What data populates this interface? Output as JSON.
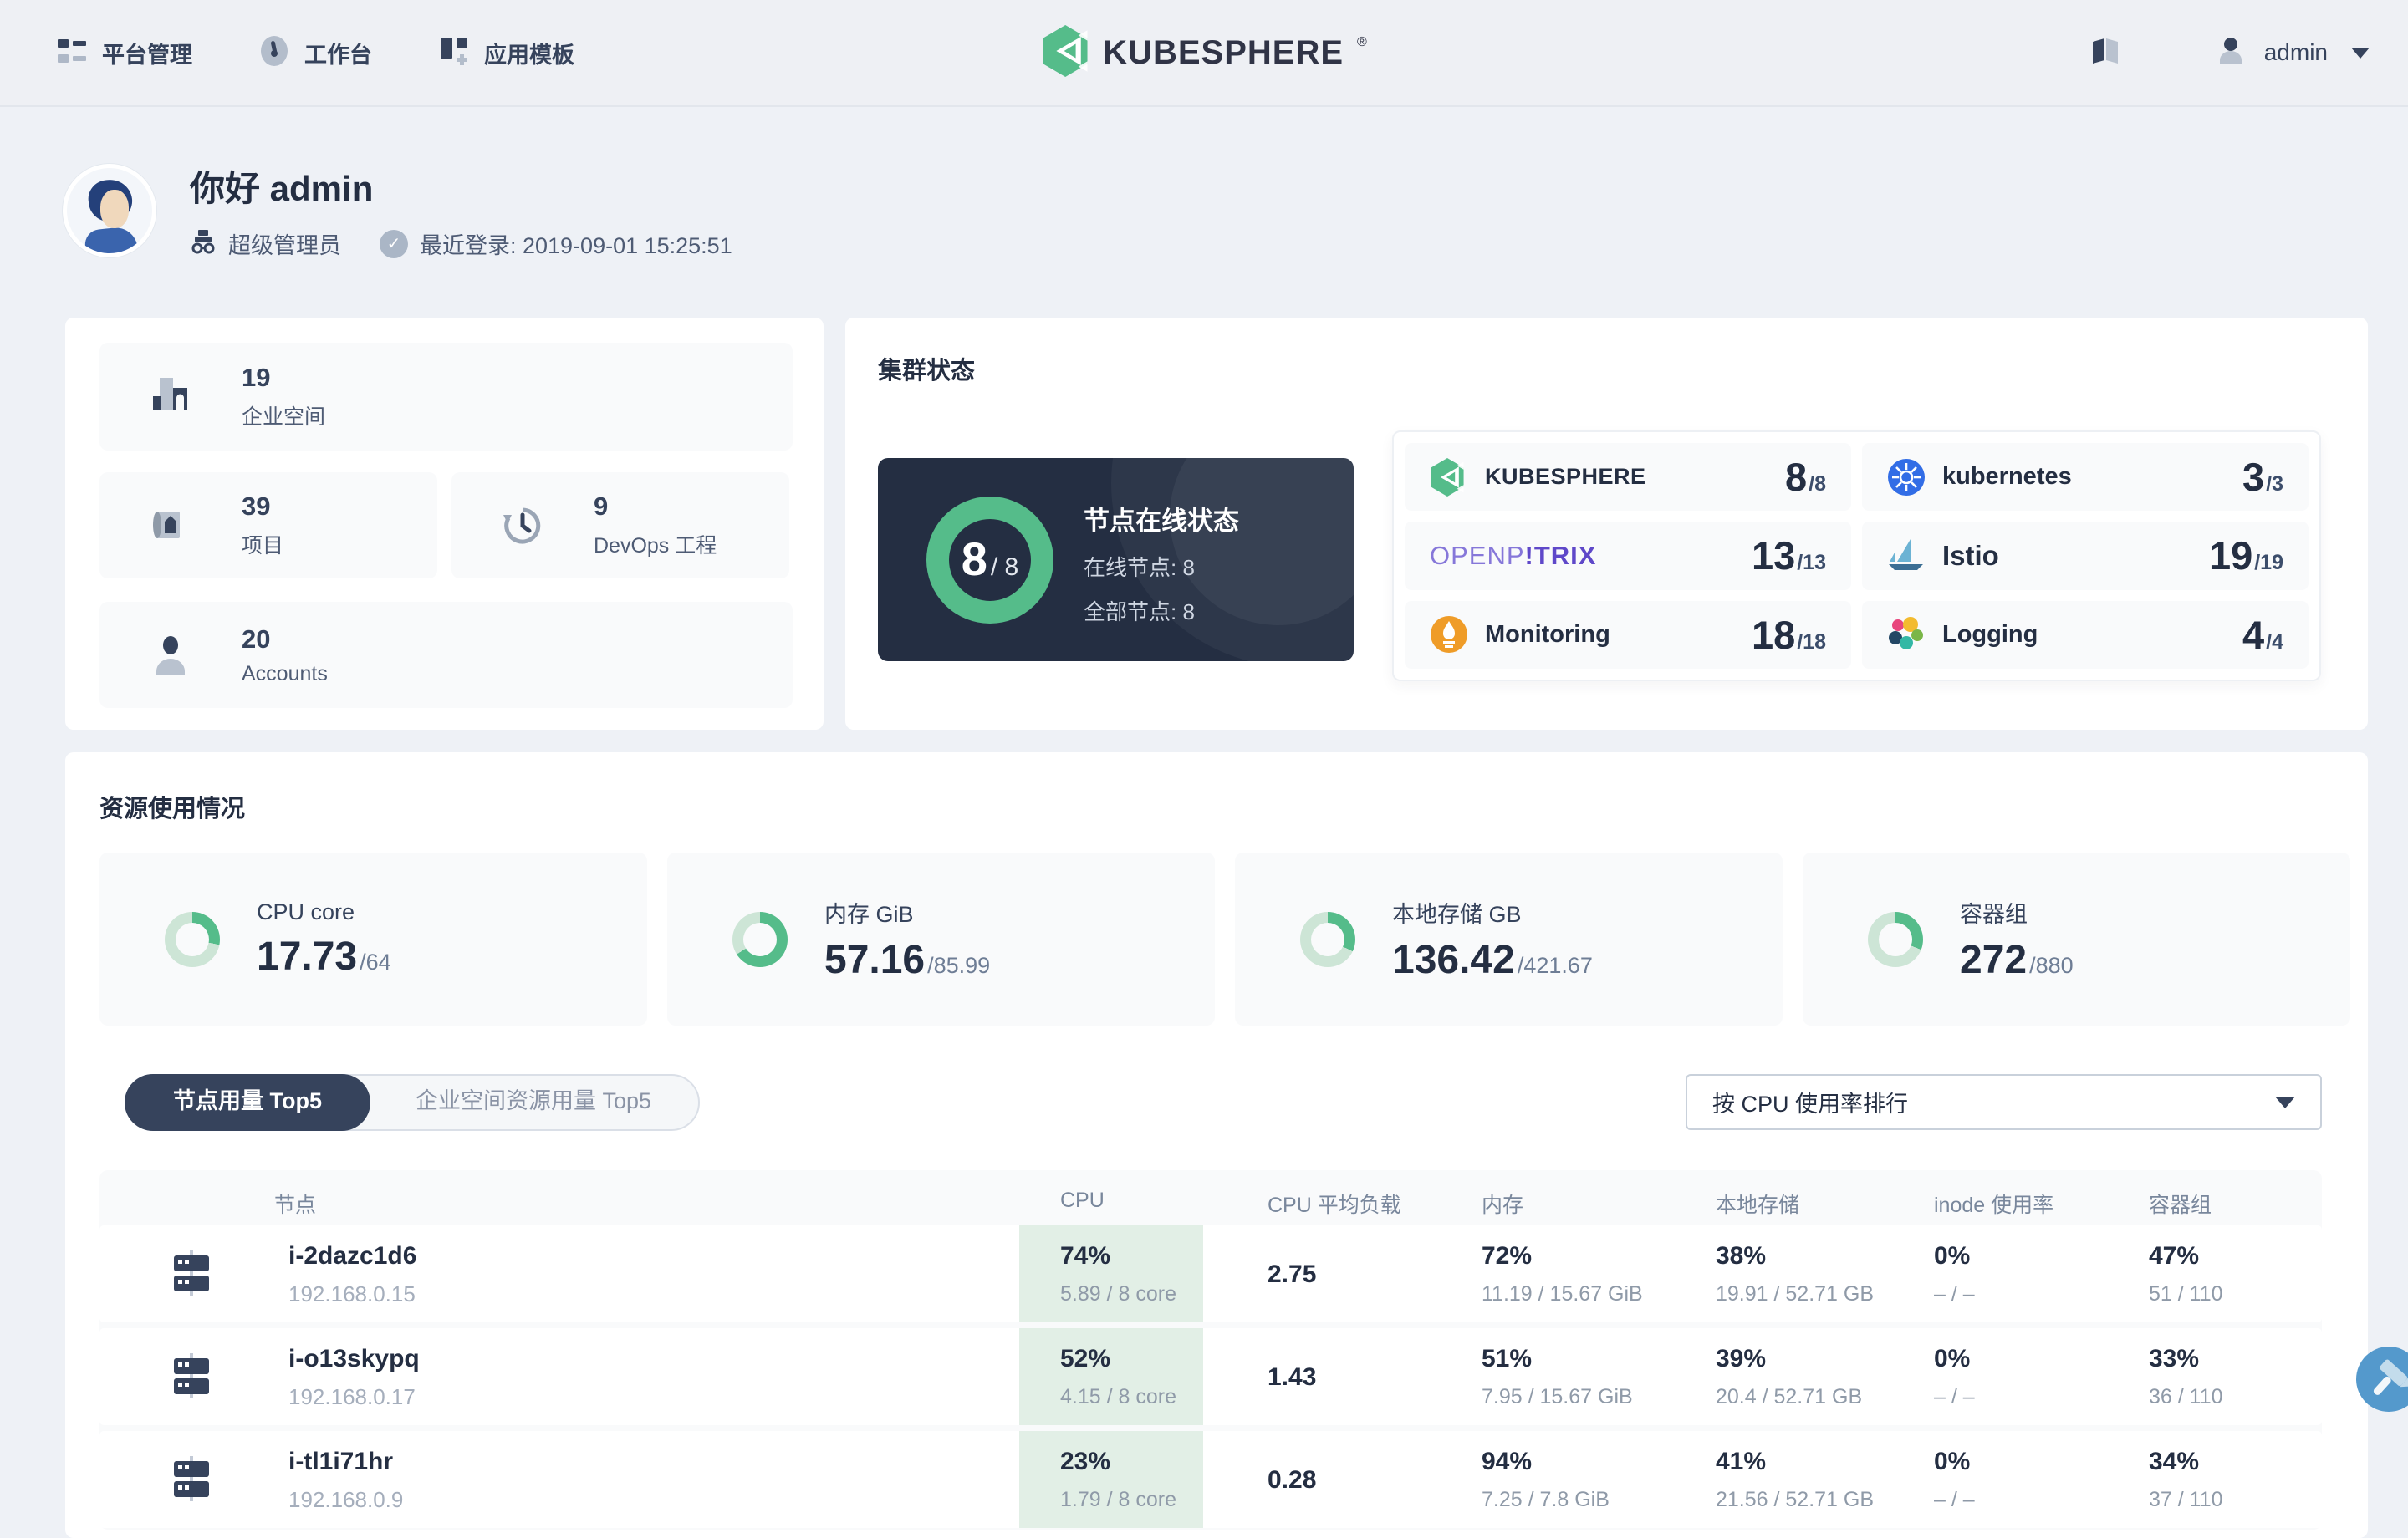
{
  "colors": {
    "green": "#55bc8a",
    "green_track": "#cde5d6",
    "dark_navy": "#242e42",
    "kubernetes_blue": "#326de6",
    "monitoring_orange": "#ef9c28",
    "fab_blue": "#5499cc",
    "cpu_cell_bg": "#e2efe6"
  },
  "nav": {
    "items": [
      {
        "label": "平台管理",
        "icon": "platform-list-icon"
      },
      {
        "label": "工作台",
        "icon": "workbench-gauge-icon"
      },
      {
        "label": "应用模板",
        "icon": "app-template-icon"
      }
    ],
    "brand": "KUBESPHERE",
    "brand_reg": "®",
    "user": "admin"
  },
  "greeting": {
    "hello": "你好 admin",
    "role": "超级管理员",
    "last_login": "最近登录: 2019-09-01 15:25:51"
  },
  "stats": [
    {
      "value": "19",
      "label": "企业空间"
    },
    {
      "value": "39",
      "label": "项目"
    },
    {
      "value": "9",
      "label": "DevOps 工程"
    },
    {
      "value": "20",
      "label": "Accounts"
    }
  ],
  "cluster": {
    "title": "集群状态",
    "donut_value": "8",
    "donut_total": "/ 8",
    "node_status_title": "节点在线状态",
    "online_line": "在线节点: 8",
    "total_line": "全部节点: 8",
    "services": [
      {
        "name": "KUBESPHERE",
        "value": "8",
        "total": "/8"
      },
      {
        "name": "kubernetes",
        "value": "3",
        "total": "/3"
      },
      {
        "name_a": "OPENP",
        "name_b": "!TRIX",
        "value": "13",
        "total": "/13"
      },
      {
        "name": "Istio",
        "value": "19",
        "total": "/19"
      },
      {
        "name": "Monitoring",
        "value": "18",
        "total": "/18"
      },
      {
        "name": "Logging",
        "value": "4",
        "total": "/4"
      }
    ]
  },
  "resources": {
    "title": "资源使用情况",
    "cards": [
      {
        "label": "CPU core",
        "value": "17.73",
        "total": "/64",
        "pct": 28
      },
      {
        "label": "内存 GiB",
        "value": "57.16",
        "total": "/85.99",
        "pct": 66
      },
      {
        "label": "本地存储 GB",
        "value": "136.42",
        "total": "/421.67",
        "pct": 32
      },
      {
        "label": "容器组",
        "value": "272",
        "total": "/880",
        "pct": 31
      }
    ],
    "tabs": [
      {
        "label": "节点用量 Top5"
      },
      {
        "label": "企业空间资源用量 Top5"
      }
    ],
    "sort_dropdown": "按 CPU 使用率排行"
  },
  "table": {
    "headers": [
      "节点",
      "CPU",
      "CPU 平均负载",
      "内存",
      "本地存储",
      "inode 使用率",
      "容器组"
    ],
    "rows": [
      {
        "name": "i-2dazc1d6",
        "ip": "192.168.0.15",
        "cpu_pct": "74%",
        "cpu_detail": "5.89 / 8 core",
        "load": "2.75",
        "mem_pct": "72%",
        "mem_detail": "11.19 / 15.67 GiB",
        "disk_pct": "38%",
        "disk_detail": "19.91 / 52.71 GB",
        "inode_pct": "0%",
        "inode_detail": "– / –",
        "pod_pct": "47%",
        "pod_detail": "51 / 110"
      },
      {
        "name": "i-o13skypq",
        "ip": "192.168.0.17",
        "cpu_pct": "52%",
        "cpu_detail": "4.15 / 8 core",
        "load": "1.43",
        "mem_pct": "51%",
        "mem_detail": "7.95 / 15.67 GiB",
        "disk_pct": "39%",
        "disk_detail": "20.4 / 52.71 GB",
        "inode_pct": "0%",
        "inode_detail": "– / –",
        "pod_pct": "33%",
        "pod_detail": "36 / 110"
      },
      {
        "name": "i-tl1i71hr",
        "ip": "192.168.0.9",
        "cpu_pct": "23%",
        "cpu_detail": "1.79 / 8 core",
        "load": "0.28",
        "mem_pct": "94%",
        "mem_detail": "7.25 / 7.8 GiB",
        "disk_pct": "41%",
        "disk_detail": "21.56 / 52.71 GB",
        "inode_pct": "0%",
        "inode_detail": "– / –",
        "pod_pct": "34%",
        "pod_detail": "37 / 110"
      }
    ]
  }
}
